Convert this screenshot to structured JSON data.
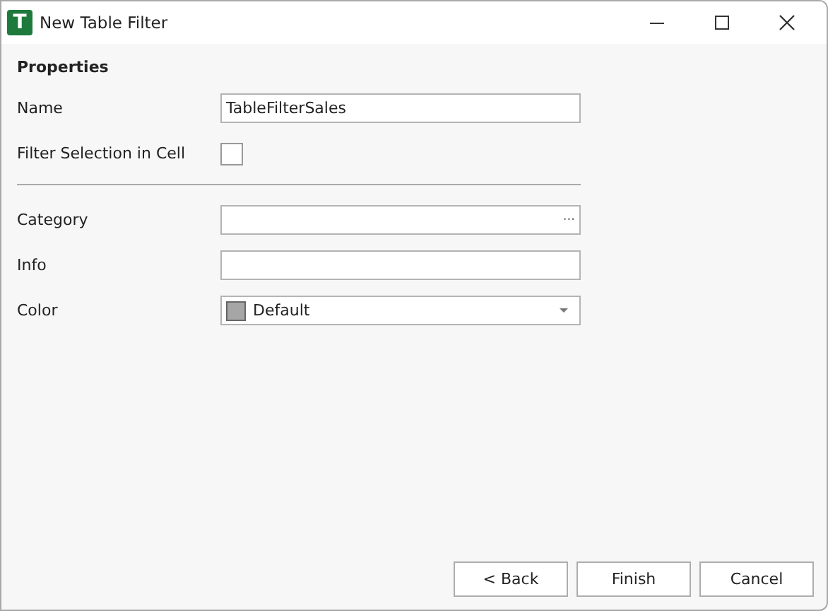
{
  "window": {
    "app_letter": "T",
    "title": "New Table Filter"
  },
  "section": "Properties",
  "fields": [
    {
      "kind": "text",
      "label": "Name",
      "value": "TableFilterSales"
    },
    {
      "kind": "checkbox",
      "label": "Filter Selection in Cell",
      "checked": false
    },
    {
      "kind": "divider"
    },
    {
      "kind": "browse",
      "label": "Category",
      "button": "···"
    },
    {
      "kind": "text",
      "label": "Info"
    },
    {
      "kind": "color",
      "label": "Color",
      "value": "Default",
      "color": "#a6a6a6"
    }
  ],
  "buttons": [
    "< Back",
    "Finish",
    "Cancel"
  ]
}
